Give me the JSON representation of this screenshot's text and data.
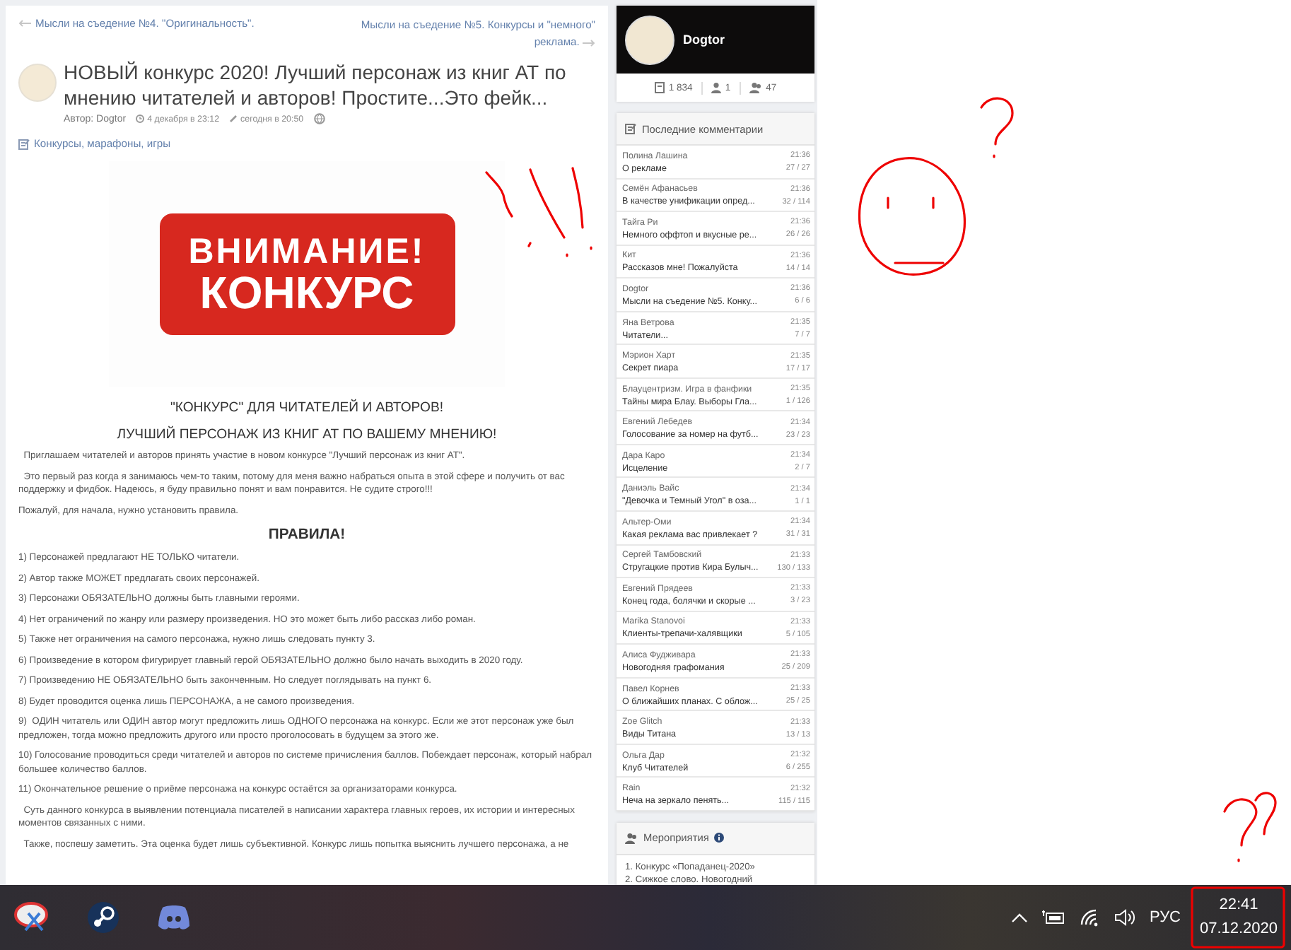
{
  "article": {
    "nav": {
      "previous": "Мысли на съедение №4. \"Оригинальность\".",
      "next": "Мысли на съедение №5. Конкурсы и \"немного\" реклама."
    },
    "title": "НОВЫЙ конкурс 2020! Лучший персонаж из книг АТ по мнению читателей и авторов! Простите...Это фейк...",
    "author": "Автор: Dogtor",
    "published": "4 декабря в 23:12",
    "edited": "сегодня в 20:50",
    "category": "Конкурсы, марафоны, игры",
    "banner": {
      "line_1": "ВНИМАНИЕ!",
      "line_2": "КОНКУРС"
    },
    "blocks": [
      {
        "kind": "heading",
        "text": "\"КОНКУРС\" ДЛЯ ЧИТАТЕЛЕЙ И АВТОРОВ!"
      },
      {
        "kind": "heading",
        "text": "ЛУЧШИЙ ПЕРСОНАЖ ИЗ КНИГ АТ ПО ВАШЕМУ МНЕНИЮ!"
      },
      {
        "kind": "paragraph",
        "text": "  Приглашаем читателей и авторов принять участие в новом конкурсе \"Лучший персонаж из книг АТ\"."
      },
      {
        "kind": "paragraph",
        "text": "  Это первый раз когда я занимаюсь чем-то таким, потому для меня важно набраться опыта в этой сфере и получить от вас поддержку и фидбок. Надеюсь, я буду правильно понят и вам понравится. Не судите строго!!!"
      },
      {
        "kind": "paragraph",
        "text": "Пожалуй, для начала, нужно установить правила."
      },
      {
        "kind": "title",
        "text": "ПРАВИЛА!"
      },
      {
        "kind": "paragraph",
        "text": "1) Персонажей предлагают НЕ ТОЛЬКО читатели."
      },
      {
        "kind": "paragraph",
        "text": "2) Автор также МОЖЕТ предлагать своих персонажей."
      },
      {
        "kind": "paragraph",
        "text": "3) Персонажи ОБЯЗАТЕЛЬНО должны быть главными героями."
      },
      {
        "kind": "paragraph",
        "text": "4) Нет ограничений по жанру или размеру произведения. НО это может быть либо рассказ либо роман."
      },
      {
        "kind": "paragraph",
        "text": "5) Также нет ограничения на самого персонажа, нужно лишь следовать пункту 3."
      },
      {
        "kind": "paragraph",
        "text": "6) Произведение в котором фигурирует главный герой ОБЯЗАТЕЛЬНО должно было начать выходить в 2020 году."
      },
      {
        "kind": "paragraph",
        "text": "7) Произведению НЕ ОБЯЗАТЕЛЬНО быть законченным. Но следует поглядывать на пункт 6."
      },
      {
        "kind": "paragraph",
        "text": "8) Будет проводится оценка лишь ПЕРСОНАЖА, а не самого произведения."
      },
      {
        "kind": "paragraph",
        "text": "9)  ОДИН читатель или ОДИН автор могут предложить лишь ОДНОГО персонажа на конкурс. Если же этот персонаж уже был предложен, тогда можно предложить другого или просто проголосовать в будущем за этого же."
      },
      {
        "kind": "paragraph",
        "text": "10) Голосование проводиться среди читателей и авторов по системе причисления баллов. Побеждает персонаж, который набрал большее количество баллов."
      },
      {
        "kind": "paragraph",
        "text": "11) Окончательное решение о приёме персонажа на конкурс остаётся за организаторами конкурса."
      },
      {
        "kind": "paragraph",
        "text": "  Суть данного конкурса в выявлении потенциала писателей в написании характера главных героев, их истории и интересных моментов связанных с ними."
      },
      {
        "kind": "paragraph",
        "text": "  Также, поспешу заметить. Эта оценка будет лишь субъективной. Конкурс лишь попытка выяснить лучшего персонажа, а не"
      }
    ]
  },
  "profile": {
    "name": "Dogtor",
    "stats": [
      "1 834",
      "1",
      "47"
    ]
  },
  "comments": {
    "title": "Последние комментарии",
    "items": [
      {
        "author": "Полина Лашина",
        "time": "21:36",
        "topic": "О рекламе",
        "count": "27 / 27"
      },
      {
        "author": "Семён Афанасьев",
        "time": "21:36",
        "topic": "В качестве унификации опред...",
        "count": "32 / 114"
      },
      {
        "author": "Тайга Ри",
        "time": "21:36",
        "topic": "Немного оффтоп и вкусные ре...",
        "count": "26 / 26"
      },
      {
        "author": "Кит",
        "time": "21:36",
        "topic": "Рассказов мне! Пожалуйста",
        "count": "14 / 14"
      },
      {
        "author": "Dogtor",
        "time": "21:36",
        "topic": "Мысли на съедение №5. Конку...",
        "count": "6 / 6"
      },
      {
        "author": "Яна Ветрова",
        "time": "21:35",
        "topic": "Читатели...",
        "count": "7 / 7"
      },
      {
        "author": "Мэрион Харт",
        "time": "21:35",
        "topic": "Секрет пиара",
        "count": "17 / 17"
      },
      {
        "author": "Блауцентризм. Игра в фанфики",
        "time": "21:35",
        "topic": "Тайны мира Блау. Выборы Гла...",
        "count": "1 / 126"
      },
      {
        "author": "Евгений Лебедев",
        "time": "21:34",
        "topic": "Голосование за номер на футб...",
        "count": "23 / 23"
      },
      {
        "author": "Дара Каро",
        "time": "21:34",
        "topic": "Исцеление",
        "count": "2 / 7"
      },
      {
        "author": "Даниэль Вайс",
        "time": "21:34",
        "topic": "\"Девочка и Темный Угол\" в оза...",
        "count": "1 / 1"
      },
      {
        "author": "Альтер-Оми",
        "time": "21:34",
        "topic": "Какая реклама вас привлекает ?",
        "count": "31 / 31"
      },
      {
        "author": "Сергей Тамбовский",
        "time": "21:33",
        "topic": "Стругацкие против Кира Булыч...",
        "count": "130 / 133"
      },
      {
        "author": "Евгений Прядеев",
        "time": "21:33",
        "topic": "Конец года, болячки и скорые ...",
        "count": "3 / 23"
      },
      {
        "author": "Marika Stanovoi",
        "time": "21:33",
        "topic": "Клиенты-трепачи-халявщики",
        "count": "5 / 105"
      },
      {
        "author": "Алиса Фудживара",
        "time": "21:33",
        "topic": "Новогодняя графомания",
        "count": "25 / 209"
      },
      {
        "author": "Павел Корнев",
        "time": "21:33",
        "topic": "О ближайших планах. С облож...",
        "count": "25 / 25"
      },
      {
        "author": "Zoe Glitch",
        "time": "21:33",
        "topic": "Виды Титана",
        "count": "13 / 13"
      },
      {
        "author": "Ольга Дар",
        "time": "21:32",
        "topic": "Клуб Читателей",
        "count": "6 / 255"
      },
      {
        "author": "Rain",
        "time": "21:32",
        "topic": "Неча на зеркало пенять...",
        "count": "115 / 115"
      }
    ]
  },
  "events": {
    "title": "Мероприятия",
    "items": [
      "1. Конкурс «Попаданец-2020»",
      "2. Сижкое слово. Новогодний"
    ]
  },
  "taskbar": {
    "language": "РУС",
    "time": "22:41",
    "date": "07.12.2020"
  }
}
